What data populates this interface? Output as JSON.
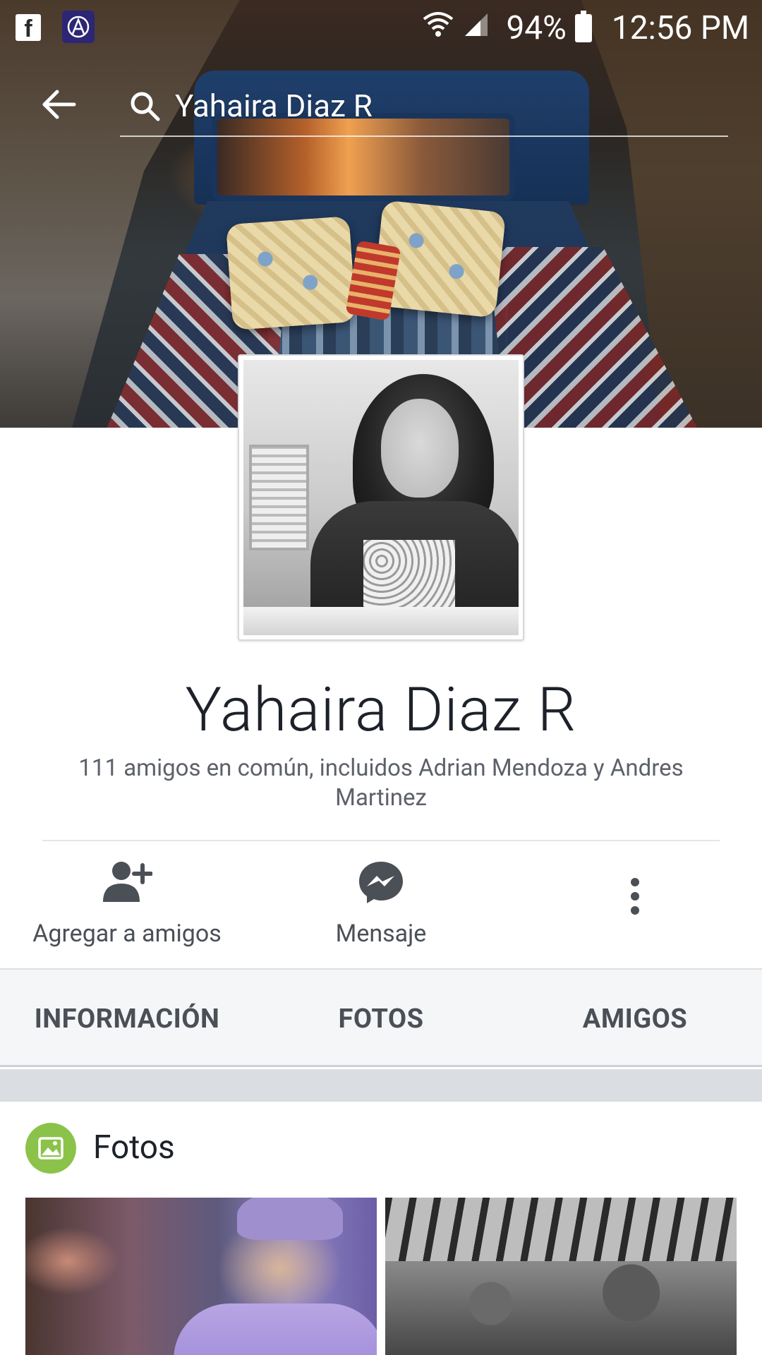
{
  "status_bar": {
    "battery": "94%",
    "time": "12:56 PM"
  },
  "search": {
    "query": "Yahaira Diaz R"
  },
  "profile": {
    "name": "Yahaira Diaz R",
    "mutual_friends": "111 amigos en común, incluidos Adrian Mendoza y Andres Martinez"
  },
  "actions": {
    "add_friend": "Agregar a amigos",
    "message": "Mensaje"
  },
  "tabs": [
    {
      "label": "INFORMACIÓN"
    },
    {
      "label": "FOTOS"
    },
    {
      "label": "AMIGOS"
    }
  ],
  "photos_section": {
    "title": "Fotos"
  },
  "colors": {
    "photos_icon_bg": "#8bc34a",
    "icon_gray": "#4b4f56",
    "tab_bg": "#f5f6f8"
  }
}
